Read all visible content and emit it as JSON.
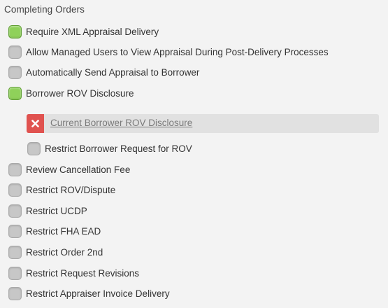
{
  "section": {
    "title": "Completing Orders"
  },
  "options": [
    {
      "label": "Require XML Appraisal Delivery",
      "checked": true
    },
    {
      "label": "Allow Managed Users to View Appraisal During Post-Delivery Processes",
      "checked": false
    },
    {
      "label": "Automatically Send Appraisal to Borrower",
      "checked": false
    },
    {
      "label": "Borrower ROV Disclosure",
      "checked": true
    },
    {
      "label": "Review Cancellation Fee",
      "checked": false
    },
    {
      "label": "Restrict ROV/Dispute",
      "checked": false
    },
    {
      "label": "Restrict UCDP",
      "checked": false
    },
    {
      "label": "Restrict FHA EAD",
      "checked": false
    },
    {
      "label": "Restrict Order 2nd",
      "checked": false
    },
    {
      "label": "Restrict Request Revisions",
      "checked": false
    },
    {
      "label": "Restrict Appraiser Invoice Delivery",
      "checked": false
    }
  ],
  "rov": {
    "document_link": "Current Borrower ROV Disclosure",
    "delete_icon": "close-icon",
    "sub_option": {
      "label": "Restrict Borrower Request for ROV",
      "checked": false
    }
  },
  "colors": {
    "checked": "#8fd15a",
    "unchecked": "#c7c7c7",
    "delete": "#e0524f"
  }
}
